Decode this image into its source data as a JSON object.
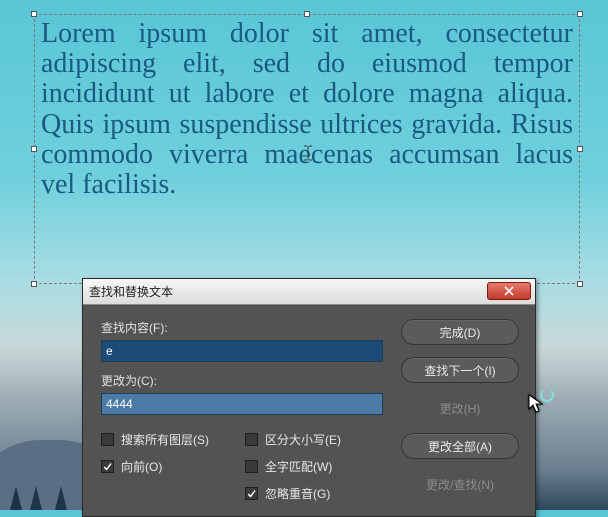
{
  "canvas_text": "Lorem ipsum dolor sit amet, consec­tetur adipiscing elit, sed do eiusmod tempor incididunt ut labore et dolore magna aliqua. Quis ipsum sus­pendisse ultrices gravida. Risus com­modo viverra maecenas accumsan lacus vel facilisis.",
  "dialog": {
    "title": "查找和替换文本",
    "find_label": "查找内容(F):",
    "find_value": "e",
    "replace_label": "更改为(C):",
    "replace_value": "4444",
    "checkboxes": {
      "search_all_layers": {
        "label": "搜索所有图层(S)",
        "checked": false
      },
      "forward": {
        "label": "向前(O)",
        "checked": true
      },
      "case_sensitive": {
        "label": "区分大小写(E)",
        "checked": false
      },
      "whole_word": {
        "label": "全字匹配(W)",
        "checked": false
      },
      "ignore_accents": {
        "label": "忽略重音(G)",
        "checked": true
      }
    },
    "buttons": {
      "done": "完成(D)",
      "find_next": "查找下一个(I)",
      "change": "更改(H)",
      "change_all": "更改全部(A)",
      "change_find": "更改/查找(N)"
    }
  }
}
